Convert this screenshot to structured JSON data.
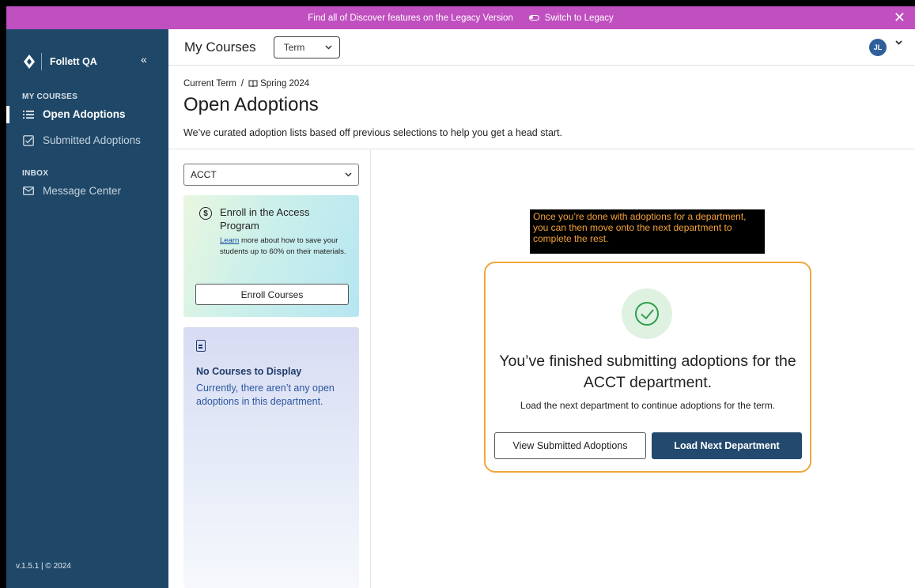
{
  "banner": {
    "message": "Find all of Discover features on the Legacy Version",
    "switch_label": "Switch to Legacy",
    "close_glyph": "✕"
  },
  "sidebar": {
    "brand": "Follett QA",
    "collapse_glyph": "«",
    "sections": {
      "my_courses": "MY COURSES",
      "inbox": "INBOX"
    },
    "items": {
      "open_adoptions": "Open Adoptions",
      "submitted_adoptions": "Submitted Adoptions",
      "message_center": "Message Center"
    },
    "version": "v.1.5.1 | © 2024"
  },
  "header": {
    "title": "My Courses",
    "term_select": "Term",
    "avatar_initials": "JL"
  },
  "page": {
    "breadcrumb_root": "Current Term",
    "breadcrumb_sep": "/",
    "breadcrumb_current": "Spring 2024",
    "title": "Open Adoptions",
    "subtitle": "We’ve curated adoption lists based off previous selections to help you get a head start."
  },
  "left": {
    "department_select": "ACCT",
    "enroll_card": {
      "heading": "Enroll in the Access Program",
      "link": "Learn",
      "description": " more about how to save your students up to 60% on their materials.",
      "button": "Enroll Courses"
    },
    "no_courses": {
      "heading": "No Courses to Display",
      "text": "Currently, there aren’t any open adoptions in this department."
    }
  },
  "annotation": {
    "text": "Once you’re done with adoptions for a department, you can then move onto the next department to complete the rest."
  },
  "success": {
    "message": "You’ve finished submitting adoptions for the ACCT department.",
    "sub": "Load the next department to continue adoptions for the term.",
    "view_button": "View Submitted Adoptions",
    "load_button": "Load Next Department"
  },
  "colors": {
    "banner": "#c04fc0",
    "sidebar": "#1f4868",
    "primary": "#234a6e",
    "highlight": "#f0a73b",
    "success": "#2f9d4e"
  },
  "icons": [
    "follett-logo-icon",
    "chevrons-left-icon",
    "list-icon",
    "checkbox-icon",
    "mail-icon",
    "book-icon",
    "chevron-down-icon",
    "dollar-bulb-icon",
    "document-icon",
    "check-circle-icon",
    "toggle-icon",
    "close-icon"
  ]
}
